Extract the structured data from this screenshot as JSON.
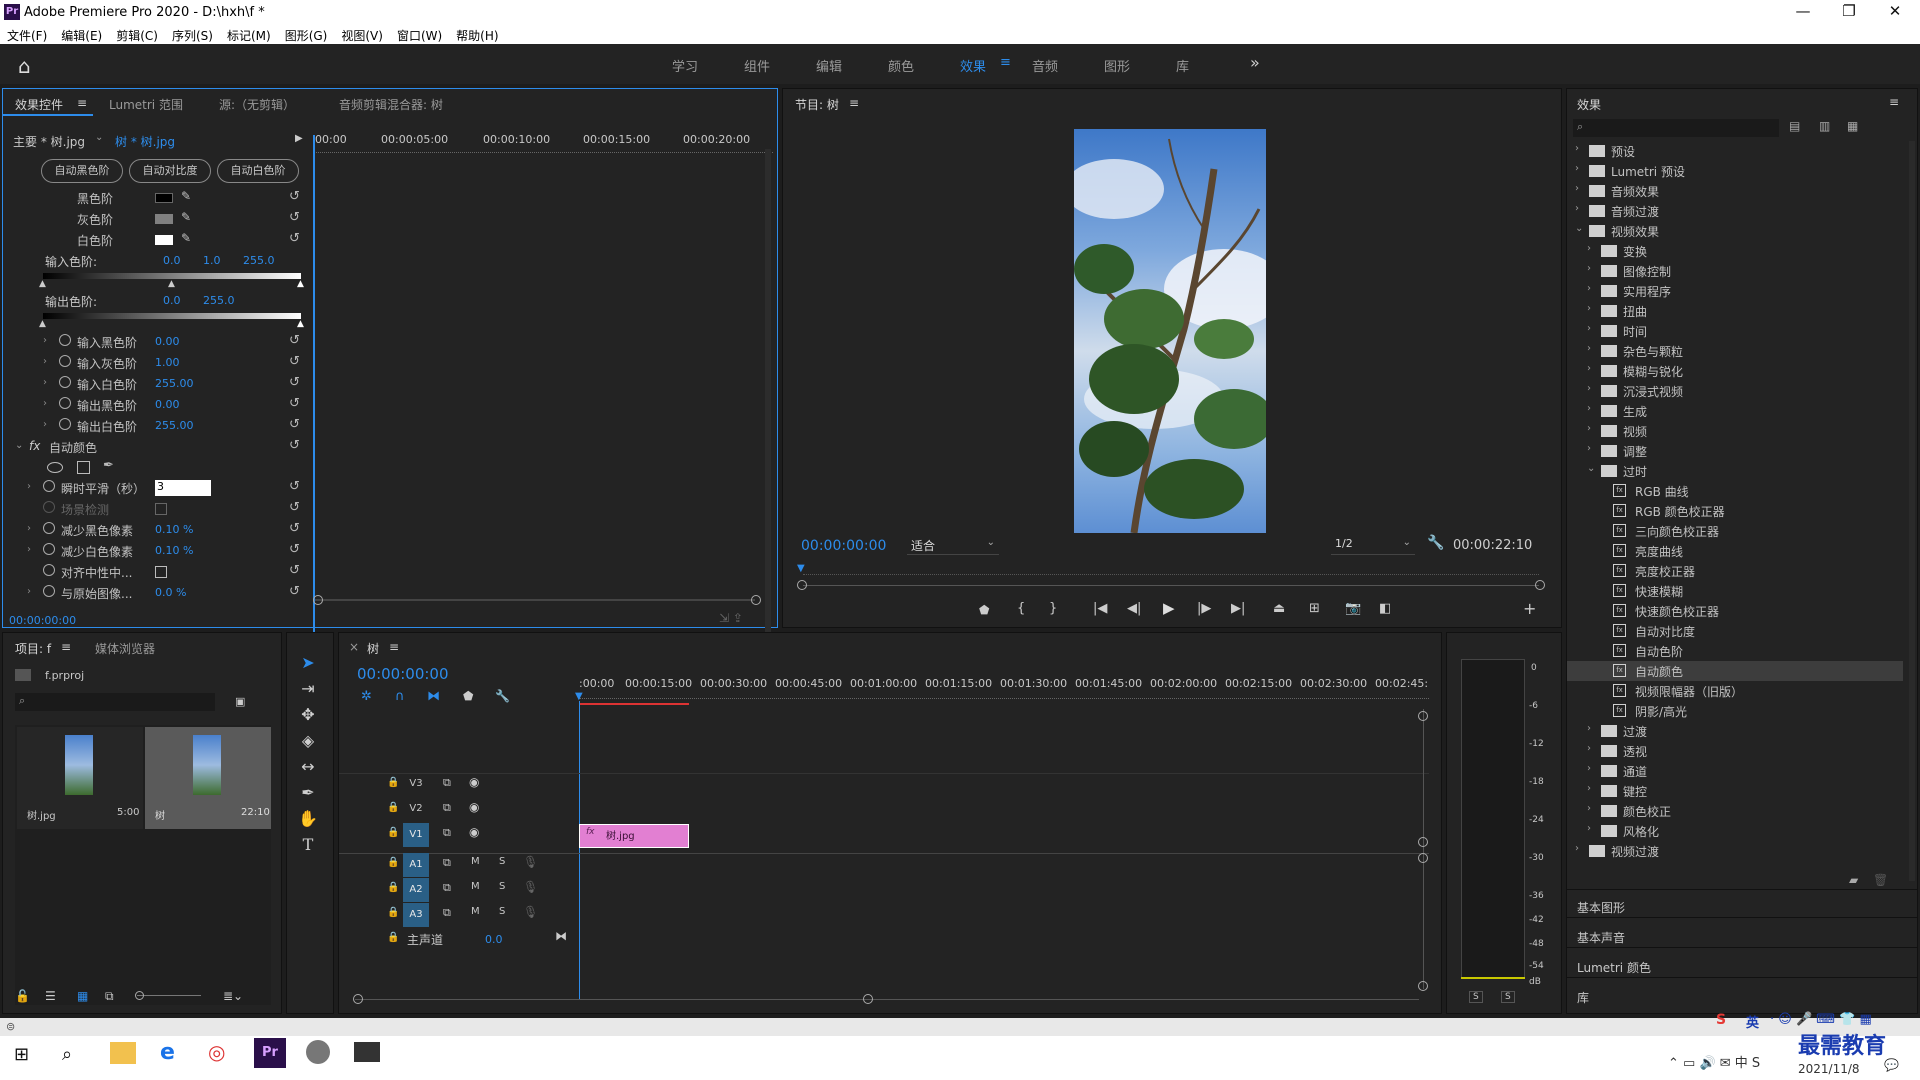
{
  "window": {
    "app_icon": "Pr",
    "title": "Adobe Premiere Pro 2020 - D:\\hxh\\f *",
    "minimize": "—",
    "maximize": "❐",
    "close": "✕"
  },
  "menu": [
    "文件(F)",
    "编辑(E)",
    "剪辑(C)",
    "序列(S)",
    "标记(M)",
    "图形(G)",
    "视图(V)",
    "窗口(W)",
    "帮助(H)"
  ],
  "workspaces": {
    "tabs": [
      "学习",
      "组件",
      "编辑",
      "颜色",
      "效果",
      "音频",
      "图形",
      "库"
    ],
    "active": "效果",
    "more": "»"
  },
  "effect_controls": {
    "tabs": [
      "效果控件",
      "Lumetri 范围",
      "源:（无剪辑）",
      "音频剪辑混合器: 树"
    ],
    "master_clip": "主要 * 树.jpg",
    "seq_clip": "树 * 树.jpg",
    "ruler": [
      "00:00",
      "00:00:05:00",
      "00:00:10:00",
      "00:00:15:00",
      "00:00:20:00"
    ],
    "auto_buttons": [
      "自动黑色阶",
      "自动对比度",
      "自动白色阶"
    ],
    "levels": [
      {
        "label": "黑色阶",
        "color": "#000000"
      },
      {
        "label": "灰色阶",
        "color": "#808080"
      },
      {
        "label": "白色阶",
        "color": "#ffffff"
      }
    ],
    "input_levels": {
      "label": "输入色阶:",
      "values": [
        "0.0",
        "1.0",
        "255.0"
      ]
    },
    "output_levels": {
      "label": "输出色阶:",
      "values": [
        "0.0",
        "255.0"
      ]
    },
    "params": [
      {
        "label": "输入黑色阶",
        "value": "0.00"
      },
      {
        "label": "输入灰色阶",
        "value": "1.00"
      },
      {
        "label": "输入白色阶",
        "value": "255.00"
      },
      {
        "label": "输出黑色阶",
        "value": "0.00"
      },
      {
        "label": "输出白色阶",
        "value": "255.00"
      }
    ],
    "auto_color": {
      "label": "自动颜色",
      "params": [
        {
          "label": "瞬时平滑（秒）",
          "value": "3"
        },
        {
          "label": "场景检测",
          "value": ""
        },
        {
          "label": "减少黑色像素",
          "value": "0.10 %"
        },
        {
          "label": "减少白色像素",
          "value": "0.10 %"
        },
        {
          "label": "对齐中性中...",
          "value": ""
        },
        {
          "label": "与原始图像...",
          "value": "0.0 %"
        }
      ]
    },
    "timecode": "00:00:00:00"
  },
  "program_monitor": {
    "title": "节目: 树",
    "timecode": "00:00:00:00",
    "fit": "适合",
    "resolution": "1/2",
    "duration": "00:00:22:10"
  },
  "project": {
    "tabs": [
      "项目: f",
      "媒体浏览器"
    ],
    "file": "f.prproj",
    "items": [
      {
        "name": "树.jpg",
        "duration": "5:00"
      },
      {
        "name": "树",
        "duration": "22:10"
      }
    ]
  },
  "timeline": {
    "tab": "树",
    "timecode": "00:00:00:00",
    "ruler": [
      ":00:00",
      "00:00:15:00",
      "00:00:30:00",
      "00:00:45:00",
      "00:01:00:00",
      "00:01:15:00",
      "00:01:30:00",
      "00:01:45:00",
      "00:02:00:00",
      "00:02:15:00",
      "00:02:30:00",
      "00:02:45:"
    ],
    "video_tracks": [
      "V3",
      "V2",
      "V1"
    ],
    "audio_tracks": [
      "A1",
      "A2",
      "A3"
    ],
    "master": {
      "label": "主声道",
      "value": "0.0"
    },
    "clip": "树.jpg",
    "mute": "M",
    "solo": "S"
  },
  "meters": {
    "scale": [
      "0",
      "-6",
      "-12",
      "-18",
      "-24",
      "-30",
      "-36",
      "-42",
      "-48",
      "-54",
      "dB"
    ],
    "solo": [
      "S",
      "S"
    ]
  },
  "effects_panel": {
    "title": "效果",
    "tree": [
      {
        "label": "预设",
        "level": 0,
        "type": "folder",
        "open": false
      },
      {
        "label": "Lumetri 预设",
        "level": 0,
        "type": "folder",
        "open": false
      },
      {
        "label": "音频效果",
        "level": 0,
        "type": "folder",
        "open": false
      },
      {
        "label": "音频过渡",
        "level": 0,
        "type": "folder",
        "open": false
      },
      {
        "label": "视频效果",
        "level": 0,
        "type": "folder",
        "open": true
      },
      {
        "label": "变换",
        "level": 1,
        "type": "folder",
        "open": false
      },
      {
        "label": "图像控制",
        "level": 1,
        "type": "folder",
        "open": false
      },
      {
        "label": "实用程序",
        "level": 1,
        "type": "folder",
        "open": false
      },
      {
        "label": "扭曲",
        "level": 1,
        "type": "folder",
        "open": false
      },
      {
        "label": "时间",
        "level": 1,
        "type": "folder",
        "open": false
      },
      {
        "label": "杂色与颗粒",
        "level": 1,
        "type": "folder",
        "open": false
      },
      {
        "label": "模糊与锐化",
        "level": 1,
        "type": "folder",
        "open": false
      },
      {
        "label": "沉浸式视频",
        "level": 1,
        "type": "folder",
        "open": false
      },
      {
        "label": "生成",
        "level": 1,
        "type": "folder",
        "open": false
      },
      {
        "label": "视频",
        "level": 1,
        "type": "folder",
        "open": false
      },
      {
        "label": "调整",
        "level": 1,
        "type": "folder",
        "open": false
      },
      {
        "label": "过时",
        "level": 1,
        "type": "folder",
        "open": true
      },
      {
        "label": "RGB 曲线",
        "level": 2,
        "type": "effect"
      },
      {
        "label": "RGB 颜色校正器",
        "level": 2,
        "type": "effect"
      },
      {
        "label": "三向颜色校正器",
        "level": 2,
        "type": "effect"
      },
      {
        "label": "亮度曲线",
        "level": 2,
        "type": "effect"
      },
      {
        "label": "亮度校正器",
        "level": 2,
        "type": "effect"
      },
      {
        "label": "快速模糊",
        "level": 2,
        "type": "effect"
      },
      {
        "label": "快速颜色校正器",
        "level": 2,
        "type": "effect"
      },
      {
        "label": "自动对比度",
        "level": 2,
        "type": "effect"
      },
      {
        "label": "自动色阶",
        "level": 2,
        "type": "effect"
      },
      {
        "label": "自动颜色",
        "level": 2,
        "type": "effect",
        "selected": true
      },
      {
        "label": "视频限幅器（旧版）",
        "level": 2,
        "type": "effect"
      },
      {
        "label": "阴影/高光",
        "level": 2,
        "type": "effect"
      },
      {
        "label": "过渡",
        "level": 1,
        "type": "folder",
        "open": false
      },
      {
        "label": "透视",
        "level": 1,
        "type": "folder",
        "open": false
      },
      {
        "label": "通道",
        "level": 1,
        "type": "folder",
        "open": false
      },
      {
        "label": "键控",
        "level": 1,
        "type": "folder",
        "open": false
      },
      {
        "label": "颜色校正",
        "level": 1,
        "type": "folder",
        "open": false
      },
      {
        "label": "风格化",
        "level": 1,
        "type": "folder",
        "open": false
      },
      {
        "label": "视频过渡",
        "level": 0,
        "type": "folder",
        "open": false
      }
    ],
    "sections": [
      "基本图形",
      "基本声音",
      "Lumetri 颜色",
      "库"
    ]
  },
  "taskbar": {
    "ime": "英",
    "date": "2021/11/8",
    "watermark": "最需教育"
  }
}
